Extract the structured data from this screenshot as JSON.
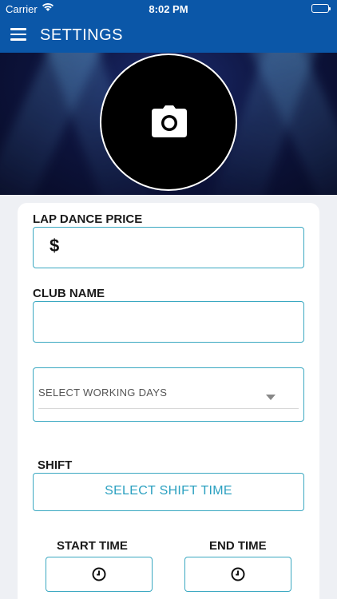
{
  "status_bar": {
    "carrier": "Carrier",
    "time": "8:02 PM"
  },
  "nav": {
    "title": "SETTINGS",
    "menu_icon": "hamburger-menu-icon"
  },
  "profile": {
    "photo_icon": "camera-icon"
  },
  "form": {
    "lap_dance_price": {
      "label": "LAP DANCE PRICE",
      "currency_symbol": "$",
      "value": ""
    },
    "club_name": {
      "label": "CLUB NAME",
      "value": ""
    },
    "working_days": {
      "placeholder": "SELECT WORKING DAYS"
    },
    "shift": {
      "label": "SHIFT",
      "button_label": "SELECT SHIFT TIME"
    },
    "start_time": {
      "label": "START TIME",
      "icon": "clock-icon"
    },
    "end_time": {
      "label": "END TIME",
      "icon": "clock-icon"
    }
  },
  "colors": {
    "nav_background": "#0b57a8",
    "field_border": "#3aa8c1",
    "accent_text": "#2aa0c0"
  }
}
